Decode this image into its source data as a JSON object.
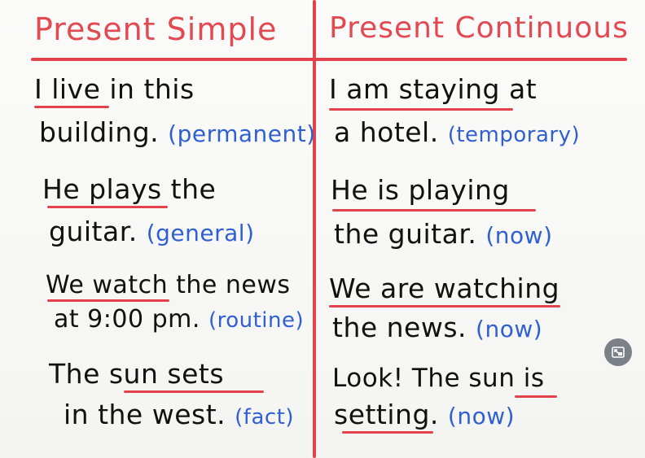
{
  "board": {
    "left": {
      "heading": "Present Simple",
      "examples": [
        {
          "line1": "I live in this",
          "line2": "building.",
          "note": "(permanent)"
        },
        {
          "line1": "He plays the",
          "line2": "guitar.",
          "note": "(general)"
        },
        {
          "line1": "We watch the news",
          "line2": "at 9:00 pm.",
          "note": "(routine)"
        },
        {
          "line1": "The sun sets",
          "line2": "in the west.",
          "note": "(fact)"
        }
      ]
    },
    "right": {
      "heading": "Present Continuous",
      "examples": [
        {
          "line1": "I am staying at",
          "line2": "a hotel.",
          "note": "(temporary)"
        },
        {
          "line1": "He is playing",
          "line2": "the guitar.",
          "note": "(now)"
        },
        {
          "line1": "We are watching",
          "line2": "the news.",
          "note": "(now)"
        },
        {
          "line1": "Look! The sun is",
          "line2": "setting.",
          "note": "(now)"
        }
      ]
    }
  },
  "colors": {
    "heading": "#e24a52",
    "text": "#111111",
    "note": "#2f5fd0",
    "rule": "#e2424b"
  },
  "controls": {
    "expand_icon": "picture-in-picture-exit-icon"
  }
}
